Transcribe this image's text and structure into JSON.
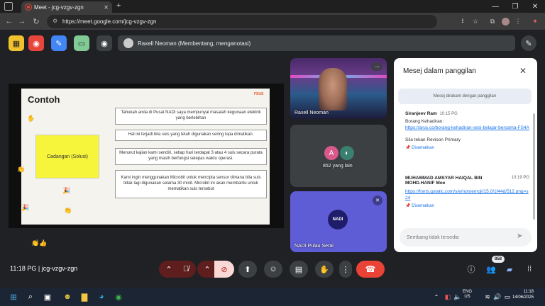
{
  "browser": {
    "tab_title": "Meet - jcg-vzgv-zgn",
    "url": "https://meet.google.com/jcg-vzgv-zgn",
    "new_tab": "+",
    "window_controls": [
      "—",
      "❐",
      "✕"
    ]
  },
  "meet_top": {
    "presenter_text": "Raxell Neoman (Membentang, menganotasi)",
    "tool_colors": [
      "#f2c12e",
      "#e8453c",
      "#4285f4",
      "#81c995",
      "#3c4043"
    ]
  },
  "slide": {
    "title": "Contoh",
    "logo": "FSUS",
    "yellow_label": "Cadangan (Solusi)",
    "boxes": [
      "Tahukah anda di Pusat NADI saya mempunyai masalah kegunaan elektrik yang berlebihan",
      "Hal ini terjadi bila suis yang telah digunakan sering lupa dimatikan.",
      "Menurut kajian kami sendiri, setiap hari terdapat 3 atau 4 suis secara purata yang masih berfungsi selepas waktu operasi.",
      "Kami ingin menggunakan Microbit untuk mencipta sensor dimana bila suis tidak lagi digunakan selama 30 minit. Microbit ini akan membantu untuk mematikan suis tersebut"
    ]
  },
  "tiles": {
    "presenter_name": "Raxell Neoman",
    "others_initial": "A",
    "others_label": "852 yang lain",
    "nadi_logo": "NADI",
    "nadi_name": "NADI Pulau Serai"
  },
  "chat": {
    "title": "Mesej dalam panggilan",
    "info": "Mesej dirakam dengan panggilan",
    "messages": [
      {
        "name": "Siranjeev Ram",
        "time": "10:15 PG",
        "text": "Borang Kehadiran:",
        "link": "https://arus.co/borang-kehadiran-sesi-belajar-bersama-FS4A",
        "text2": "Sila tekan Revison Primary",
        "pinned": "Disematkan"
      },
      {
        "name": "MUHAMMAD AMSYAR HAIQAL BIN MOHD.HANIF Moe",
        "time": "10:19 PG",
        "link": "https://fonts.gstatic.com/s/e/notoemoji/15.0/1f44d/512.png=s24",
        "pinned": "Disematkan"
      }
    ],
    "input_placeholder": "Sembang tidak tersedia"
  },
  "bottom": {
    "time": "11:18 PG",
    "separator": "|",
    "meeting_code": "jcg-vzgv-zgn",
    "participants_count": "858"
  },
  "taskbar": {
    "lang": "ENG",
    "region": "US",
    "time": "11:18",
    "date": "14/06/2025"
  }
}
